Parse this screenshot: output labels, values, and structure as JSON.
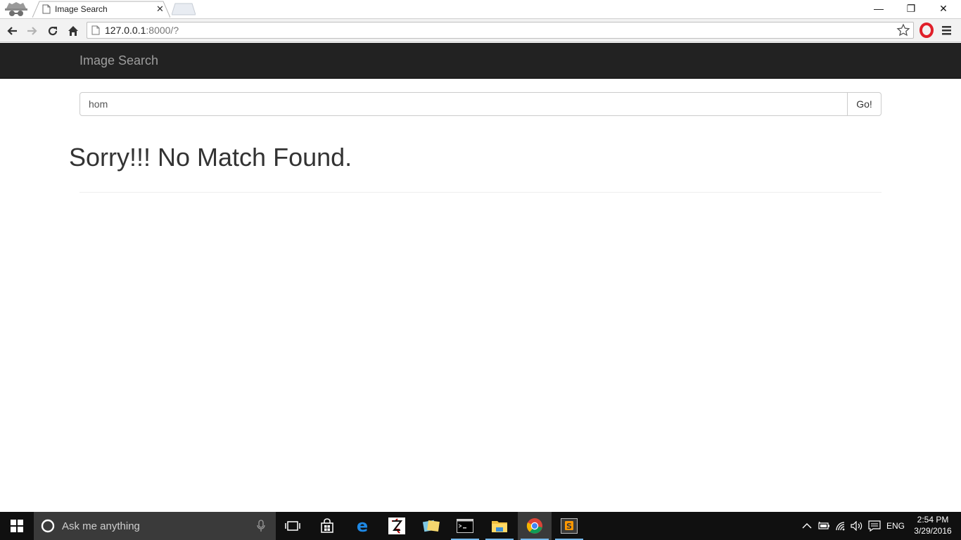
{
  "browser": {
    "tab_title": "Image Search",
    "tab_close": "✕",
    "url_host": "127.0.0.1",
    "url_path": ":8000/?",
    "window_controls": {
      "minimize": "—",
      "restore": "❐",
      "close": "✕"
    }
  },
  "page": {
    "brand": "Image Search",
    "search": {
      "value": "hom",
      "button_label": "Go!"
    },
    "message": "Sorry!!! No Match Found."
  },
  "taskbar": {
    "search_placeholder": "Ask me anything",
    "language": "ENG",
    "time": "2:54 PM",
    "date": "3/29/2016",
    "apps": [
      "task-view",
      "store",
      "edge",
      "filezilla",
      "sticky-notes",
      "cmd",
      "file-explorer",
      "chrome",
      "sublime-text"
    ]
  },
  "colors": {
    "navbar_bg": "#222222",
    "brand_text": "#9d9d9d",
    "taskbar_bg": "#101010",
    "accent_blue": "#0078d7"
  }
}
